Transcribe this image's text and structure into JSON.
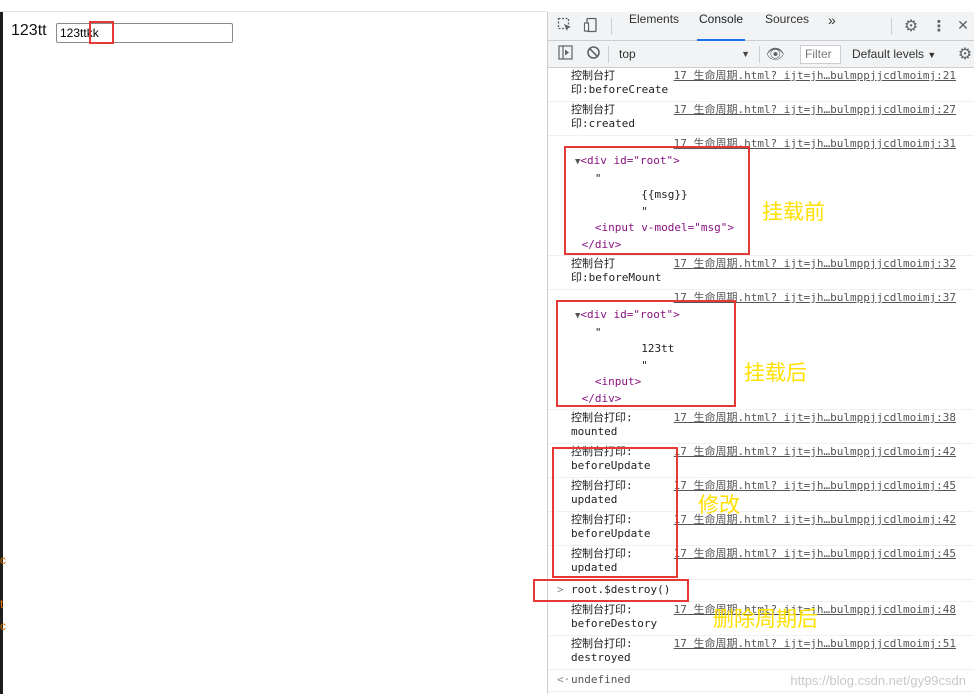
{
  "app": {
    "msg_text": "123tt",
    "input_value": "123ttkk",
    "edge_marks": [
      "c",
      "t",
      "c"
    ]
  },
  "devtools": {
    "tabs": [
      {
        "label": "Elements"
      },
      {
        "label": "Console"
      },
      {
        "label": "Sources"
      },
      {
        "label": "»"
      }
    ],
    "toolbar": {
      "context": "top",
      "filter_placeholder": "Filter",
      "levels": "Default levels"
    }
  },
  "console": {
    "rows": [
      {
        "msg": "控制台打\n印:beforeCreate",
        "src": "17 生命周期.html? ijt=jh…bulmppjjcdlmoimj:21"
      },
      {
        "msg": "控制台打\n印:created",
        "src": "17 生命周期.html? ijt=jh…bulmppjjcdlmoimj:27"
      },
      {
        "msg": "",
        "src": "17 生命周期.html? ijt=jh…bulmppjjcdlmoimj:31"
      },
      {
        "msg": "控制台打\n印:beforeMount",
        "src": "17 生命周期.html? ijt=jh…bulmppjjcdlmoimj:32"
      },
      {
        "msg": "",
        "src": "17 生命周期.html? ijt=jh…bulmppjjcdlmoimj:37"
      },
      {
        "msg": "控制台打印:\nmounted",
        "src": "17 生命周期.html? ijt=jh…bulmppjjcdlmoimj:38"
      },
      {
        "msg": "控制台打印:\nbeforeUpdate",
        "src": "17 生命周期.html? ijt=jh…bulmppjjcdlmoimj:42"
      },
      {
        "msg": "控制台打印:\nupdated",
        "src": "17 生命周期.html? ijt=jh…bulmppjjcdlmoimj:45"
      },
      {
        "msg": "控制台打印:\nbeforeUpdate",
        "src": "17 生命周期.html? ijt=jh…bulmppjjcdlmoimj:42"
      },
      {
        "msg": "控制台打印:\nupdated",
        "src": "17 生命周期.html? ijt=jh…bulmppjjcdlmoimj:45"
      },
      {
        "msg": "控制台打印:\nbeforeDestory",
        "src": "17 生命周期.html? ijt=jh…bulmppjjcdlmoimj:48"
      },
      {
        "msg": "控制台打印:\ndestroyed",
        "src": "17 生命周期.html? ijt=jh…bulmppjjcdlmoimj:51"
      }
    ],
    "tree_before": {
      "open_tag": "<div id=\"root\">",
      "quote1": "\"",
      "mustache": "{{msg}}",
      "quote2": "\"",
      "input_tag": "<input v-model=\"msg\">",
      "close_tag": "</div>"
    },
    "tree_after": {
      "open_tag": "<div id=\"root\">",
      "quote1": "\"",
      "text": "123tt",
      "quote2": "\"",
      "input_tag": "<input>",
      "close_tag": "</div>"
    },
    "command": "root.$destroy()",
    "result": "undefined"
  },
  "annotations": {
    "before_mount": "挂载前",
    "after_mount": "挂载后",
    "modify": "修改",
    "destroy": "删除周期后"
  },
  "watermark": "https://blog.csdn.net/gy99csdn"
}
